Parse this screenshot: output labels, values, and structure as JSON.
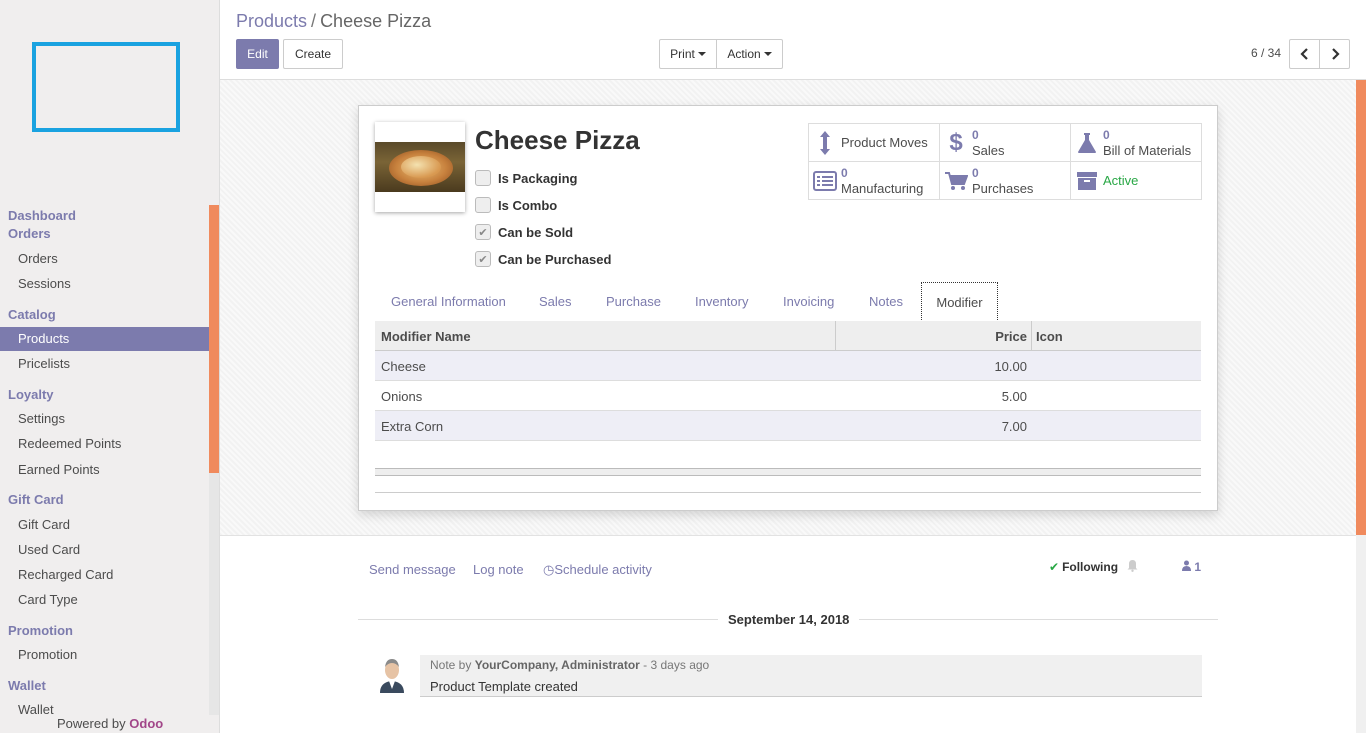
{
  "sidebar": {
    "sections": [
      {
        "label": "Dashboard"
      },
      {
        "label": "Orders"
      },
      {
        "label": "Catalog"
      },
      {
        "label": "Loyalty"
      },
      {
        "label": "Gift Card"
      },
      {
        "label": "Promotion"
      },
      {
        "label": "Wallet"
      }
    ],
    "items": [
      {
        "label": "Orders"
      },
      {
        "label": "Sessions"
      },
      {
        "label": "Products"
      },
      {
        "label": "Pricelists"
      },
      {
        "label": "Settings"
      },
      {
        "label": "Redeemed Points"
      },
      {
        "label": "Earned Points"
      },
      {
        "label": "Gift Card"
      },
      {
        "label": "Used Card"
      },
      {
        "label": "Recharged Card"
      },
      {
        "label": "Card Type"
      },
      {
        "label": "Promotion"
      },
      {
        "label": "Wallet"
      }
    ],
    "powered_prefix": "Powered by",
    "powered_brand": "Odoo",
    "brand_color": "#7c7bad",
    "accent_color": "#f08a5d"
  },
  "header": {
    "breadcrumb_parent": "Products",
    "breadcrumb_sep": "/",
    "breadcrumb_current": "Cheese Pizza",
    "edit_label": "Edit",
    "create_label": "Create",
    "print_label": "Print",
    "action_label": "Action",
    "pager": "6 / 34"
  },
  "product": {
    "name": "Cheese Pizza",
    "checkboxes": [
      {
        "label": "Is Packaging",
        "checked": false
      },
      {
        "label": "Is Combo",
        "checked": false
      },
      {
        "label": "Can be Sold",
        "checked": true
      },
      {
        "label": "Can be Purchased",
        "checked": true
      }
    ]
  },
  "smart_buttons": [
    {
      "icon": "arrows-v-icon",
      "count": "",
      "label": "Product Moves"
    },
    {
      "icon": "dollar-icon",
      "count": "0",
      "label": "Sales"
    },
    {
      "icon": "flask-icon",
      "count": "0",
      "label": "Bill of Materials"
    },
    {
      "icon": "list-alt-icon",
      "count": "0",
      "label": "Manufacturing"
    },
    {
      "icon": "shopping-cart-icon",
      "count": "0",
      "label": "Purchases"
    },
    {
      "icon": "archive-icon",
      "count": "",
      "label": "Active"
    }
  ],
  "tabs": [
    "General Information",
    "Sales",
    "Purchase",
    "Inventory",
    "Invoicing",
    "Notes",
    "Modifier"
  ],
  "modifier_table": {
    "headers": [
      "Modifier Name",
      "Price",
      "Icon"
    ],
    "rows": [
      {
        "name": "Cheese",
        "price": "10.00"
      },
      {
        "name": "Onions",
        "price": "5.00"
      },
      {
        "name": "Extra Corn",
        "price": "7.00"
      }
    ]
  },
  "chatter": {
    "send_message": "Send message",
    "log_note": "Log note",
    "schedule_activity": "Schedule activity",
    "following": "Following",
    "followers_count": "1",
    "date": "September 14, 2018",
    "note_prefix": "Note by",
    "author": "YourCompany, Administrator",
    "time": "- 3 days ago",
    "body": "Product Template created"
  }
}
